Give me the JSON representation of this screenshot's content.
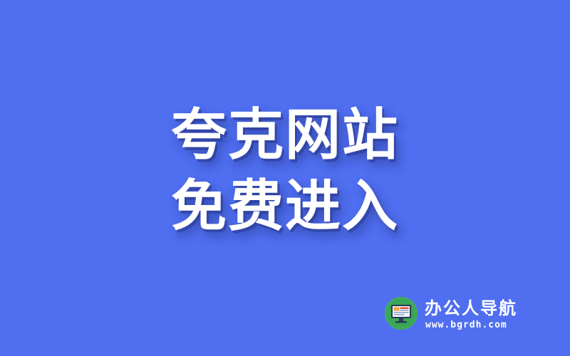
{
  "headline": {
    "line1": "夸克网站",
    "line2": "免费进入"
  },
  "brand": {
    "name": "办公人导航",
    "url": "www.bgrdh.com",
    "logo_icon": "monitor-icon"
  },
  "colors": {
    "background": "#4f6ef0",
    "headline_text": "#ffffff",
    "logo_ring": "#3aa655"
  }
}
